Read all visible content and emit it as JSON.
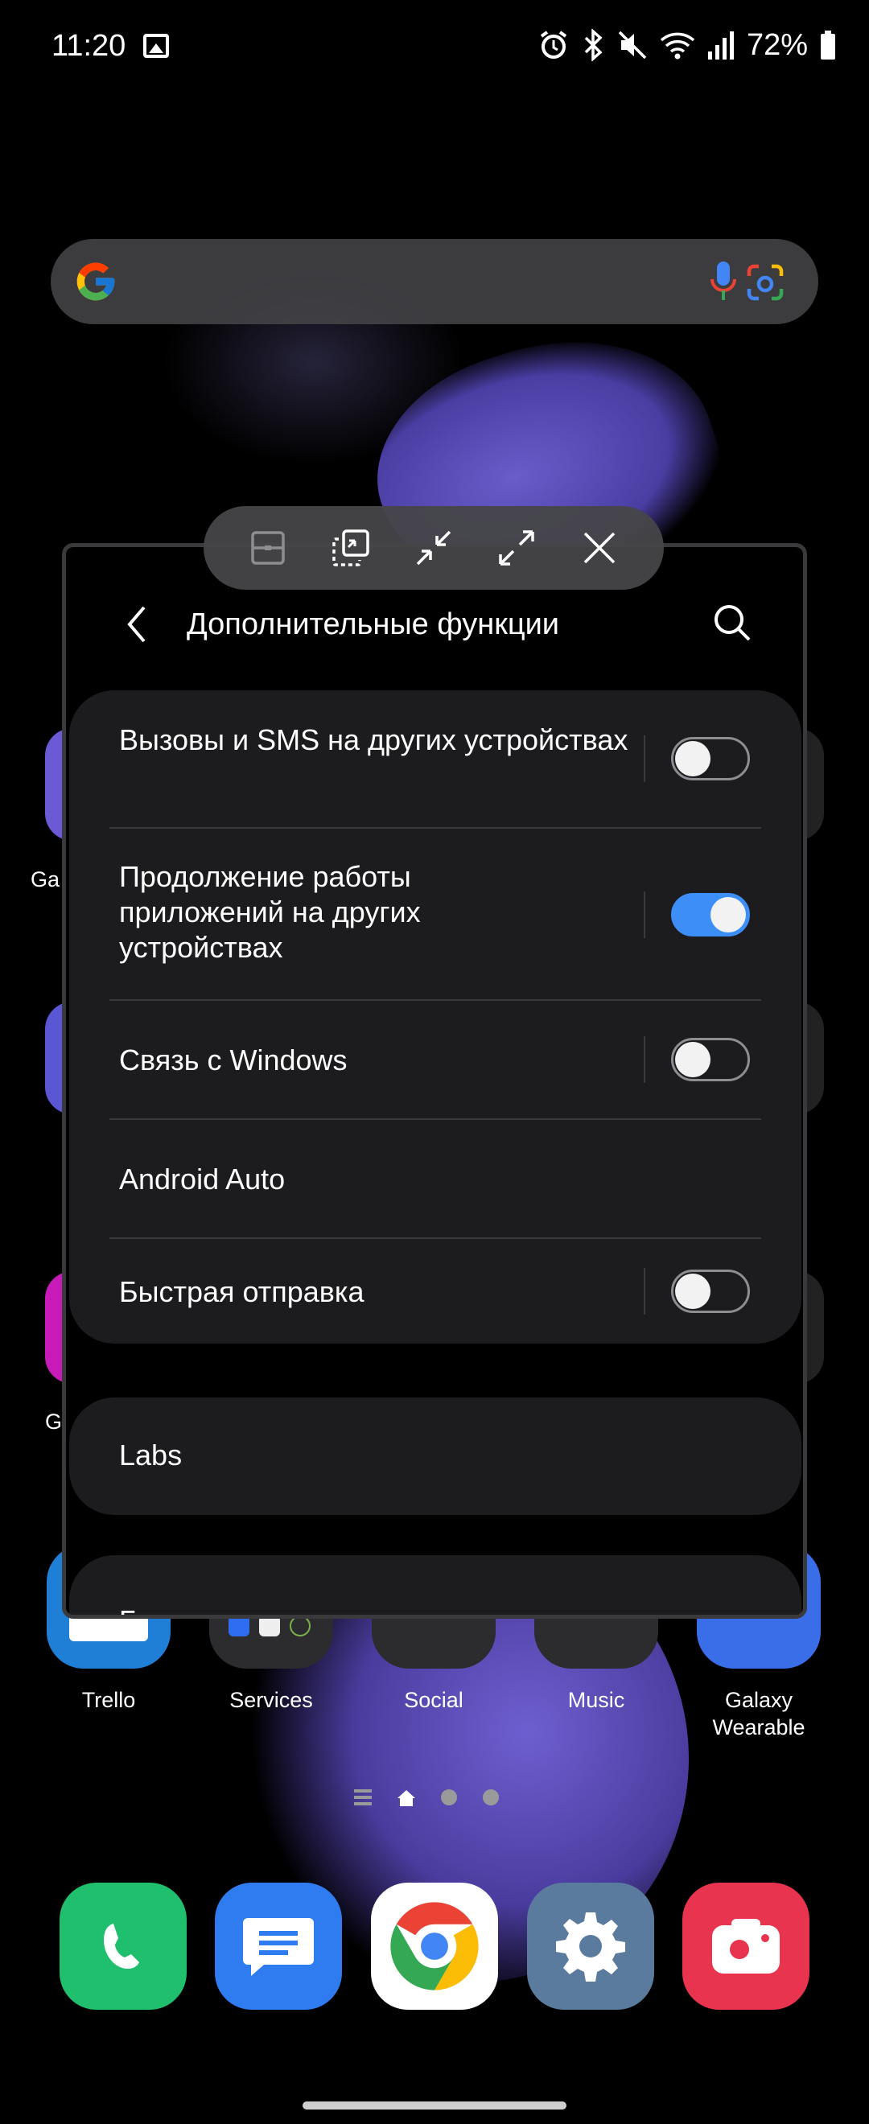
{
  "status_bar": {
    "time": "11:20",
    "battery": "72%"
  },
  "search_bar": {
    "logo": "google-g-logo",
    "icons": [
      "microphone-icon",
      "google-lens-icon"
    ]
  },
  "home_apps_row": [
    {
      "label": "Trello",
      "color": "#1f7fd6"
    },
    {
      "label": "Services",
      "color": "#3a3a3c"
    },
    {
      "label": "Social",
      "color": "#3a3a3c"
    },
    {
      "label": "Music",
      "color": "#3a3a3c"
    },
    {
      "label": "Galaxy Wearable",
      "color": "#3a6ee8"
    }
  ],
  "partial_labels": [
    "Ga",
    "G"
  ],
  "dock": [
    {
      "name": "phone",
      "color": "#1fbf6e"
    },
    {
      "name": "messages",
      "color": "#2e7cf0"
    },
    {
      "name": "chrome",
      "color": "#ffffff"
    },
    {
      "name": "settings",
      "color": "#5b7b9e"
    },
    {
      "name": "camera",
      "color": "#e8344f"
    }
  ],
  "popup_toolbar": {
    "buttons": [
      "split-view-icon",
      "pop-up-view-icon",
      "minimize-icon",
      "maximize-icon",
      "close-icon"
    ]
  },
  "window": {
    "title": "Дополнительные функции",
    "card1": [
      {
        "label": "Вызовы и SMS на других устройствах",
        "toggle": false
      },
      {
        "label": "Продолжение работы приложений на других устройствах",
        "toggle": true
      },
      {
        "label": "Связь с Windows",
        "toggle": false
      },
      {
        "label": "Android Auto",
        "toggle": null
      },
      {
        "label": "Быстрая отправка",
        "toggle": false
      }
    ],
    "card2_label": "Labs",
    "card3_label": "Боковая клавиша"
  },
  "colors": {
    "toggle_on": "#3e8ef7",
    "card_bg": "#1c1c1e"
  }
}
